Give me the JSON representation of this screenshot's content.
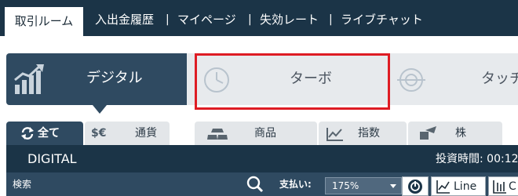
{
  "topnav": {
    "active_tab": "取引ルーム",
    "links": [
      "入出金履歴",
      "マイページ",
      "失効レート",
      "ライブチャット"
    ],
    "separator": "|"
  },
  "option_types": {
    "digital": "デジタル",
    "turbo": "ターボ",
    "touch": "タッチ"
  },
  "asset_tabs": {
    "all": "全て",
    "currency": "通貨",
    "currency_icon_text": "$€",
    "commodity": "商品",
    "index": "指数",
    "stock": "株"
  },
  "digital_bar": {
    "title": "DIGITAL",
    "time": "投資時間: 00:12"
  },
  "controls": {
    "search_label": "検索",
    "payout_label": "支払い:",
    "payout_value": "175%",
    "line_button": "Line",
    "next_button_partial": "C"
  },
  "colors": {
    "navy": "#1b3447",
    "slate": "#2f4a61",
    "highlight": "#de1c24"
  }
}
